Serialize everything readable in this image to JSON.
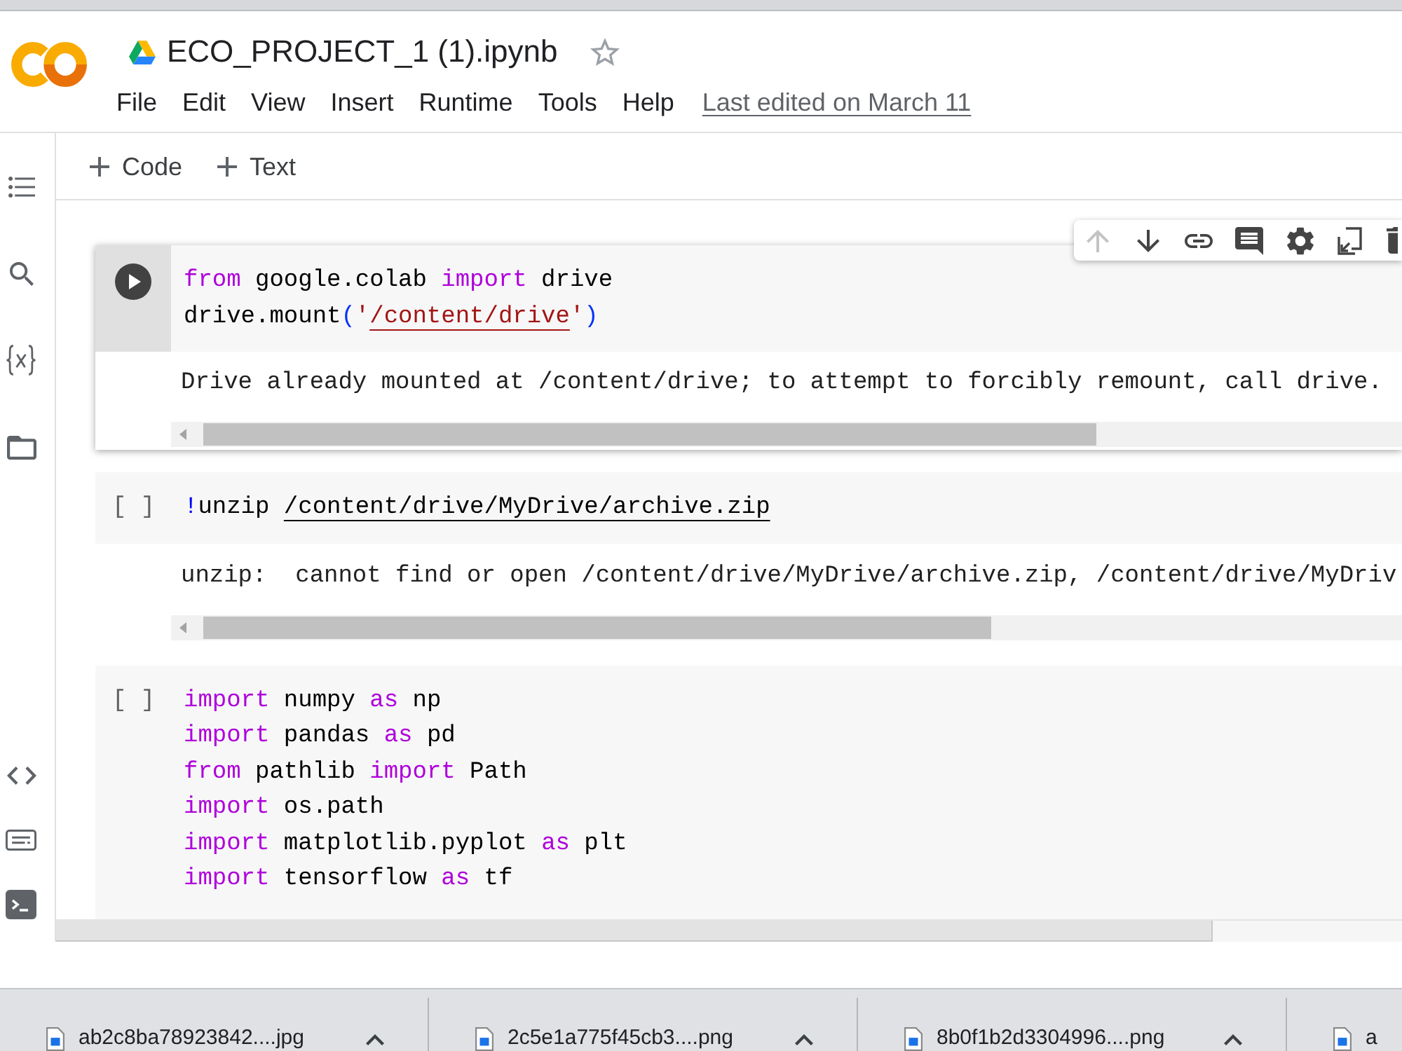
{
  "header": {
    "title": "ECO_PROJECT_1 (1).ipynb",
    "starred": false,
    "menu": [
      "File",
      "Edit",
      "View",
      "Insert",
      "Runtime",
      "Tools",
      "Help"
    ],
    "last_edited": "Last edited on March 11"
  },
  "toolbar": [
    "Code",
    "Text"
  ],
  "cells": [
    {
      "selected": true,
      "toolbar": [
        {
          "disabled": true
        },
        {
          "disabled": false
        },
        {
          "disabled": false
        },
        {
          "disabled": false
        },
        {
          "disabled": false
        },
        {
          "disabled": false
        },
        {
          "disabled": false
        }
      ],
      "code": [
        [
          {
            "kind": "keyword",
            "text": "from"
          },
          {
            "kind": "name",
            "text": " google.colab "
          },
          {
            "kind": "keyword",
            "text": "import"
          },
          {
            "kind": "name",
            "text": " drive"
          }
        ],
        [
          {
            "kind": "name",
            "text": "drive.mount"
          },
          {
            "kind": "bracket",
            "text": "("
          },
          {
            "kind": "string",
            "text": "'"
          },
          {
            "kind": "string_link",
            "text": "/content/drive"
          },
          {
            "kind": "string",
            "text": "'"
          },
          {
            "kind": "bracket",
            "text": ")"
          }
        ]
      ],
      "output": "Drive already mounted at /content/drive; to attempt to forcibly remount, call drive."
    },
    {
      "selected": false,
      "execution_count": "[ ]",
      "code": [
        [
          {
            "kind": "shell",
            "text": "!"
          },
          {
            "kind": "name",
            "text": "unzip "
          },
          {
            "kind": "path_link",
            "text": "/content/drive/MyDrive/archive.zip"
          }
        ]
      ],
      "output": "unzip:  cannot find or open /content/drive/MyDrive/archive.zip, /content/drive/MyDriv"
    },
    {
      "selected": false,
      "execution_count": "[ ]",
      "code": [
        [
          {
            "kind": "keyword",
            "text": "import"
          },
          {
            "kind": "name",
            "text": " numpy "
          },
          {
            "kind": "keyword",
            "text": "as"
          },
          {
            "kind": "name",
            "text": " np"
          }
        ],
        [
          {
            "kind": "keyword",
            "text": "import"
          },
          {
            "kind": "name",
            "text": " pandas "
          },
          {
            "kind": "keyword",
            "text": "as"
          },
          {
            "kind": "name",
            "text": " pd"
          }
        ],
        [
          {
            "kind": "keyword",
            "text": "from"
          },
          {
            "kind": "name",
            "text": " pathlib "
          },
          {
            "kind": "keyword",
            "text": "import"
          },
          {
            "kind": "name",
            "text": " Path"
          }
        ],
        [
          {
            "kind": "keyword",
            "text": "import"
          },
          {
            "kind": "name",
            "text": " os.path"
          }
        ],
        [
          {
            "kind": "keyword",
            "text": "import"
          },
          {
            "kind": "name",
            "text": " matplotlib.pyplot "
          },
          {
            "kind": "keyword",
            "text": "as"
          },
          {
            "kind": "name",
            "text": " plt"
          }
        ],
        [
          {
            "kind": "keyword",
            "text": "import"
          },
          {
            "kind": "name",
            "text": " tensorflow "
          },
          {
            "kind": "keyword",
            "text": "as"
          },
          {
            "kind": "name",
            "text": " tf"
          }
        ]
      ]
    }
  ],
  "downloads": [
    "ab2c8ba78923842....jpg",
    "2c5e1a775f45cb3....png",
    "8b0f1b2d3304996....png",
    "a"
  ]
}
